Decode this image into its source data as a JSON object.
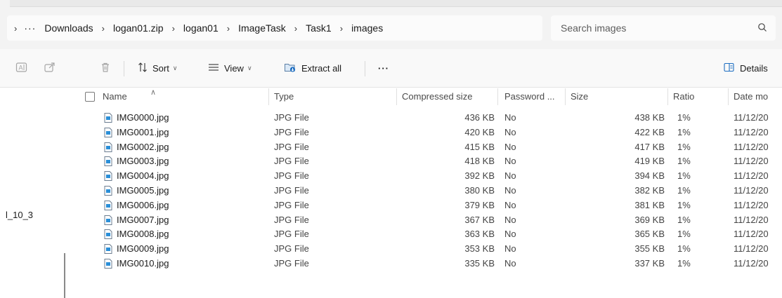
{
  "address": {
    "more": "···",
    "crumbs": [
      "Downloads",
      "logan01.zip",
      "logan01",
      "ImageTask",
      "Task1",
      "images"
    ]
  },
  "search": {
    "placeholder": "Search images"
  },
  "toolbar": {
    "sort": "Sort",
    "view": "View",
    "extract_all": "Extract all",
    "more": "···",
    "details": "Details"
  },
  "nav": {
    "partial_label": "l_10_3"
  },
  "columns": {
    "name": "Name",
    "type": "Type",
    "compressed": "Compressed size",
    "password": "Password ...",
    "size": "Size",
    "ratio": "Ratio",
    "date": "Date mo"
  },
  "files": [
    {
      "name": "IMG0000.jpg",
      "type": "JPG File",
      "compressed": "436 KB",
      "password": "No",
      "size": "438 KB",
      "ratio": "1%",
      "date": "11/12/20"
    },
    {
      "name": "IMG0001.jpg",
      "type": "JPG File",
      "compressed": "420 KB",
      "password": "No",
      "size": "422 KB",
      "ratio": "1%",
      "date": "11/12/20"
    },
    {
      "name": "IMG0002.jpg",
      "type": "JPG File",
      "compressed": "415 KB",
      "password": "No",
      "size": "417 KB",
      "ratio": "1%",
      "date": "11/12/20"
    },
    {
      "name": "IMG0003.jpg",
      "type": "JPG File",
      "compressed": "418 KB",
      "password": "No",
      "size": "419 KB",
      "ratio": "1%",
      "date": "11/12/20"
    },
    {
      "name": "IMG0004.jpg",
      "type": "JPG File",
      "compressed": "392 KB",
      "password": "No",
      "size": "394 KB",
      "ratio": "1%",
      "date": "11/12/20"
    },
    {
      "name": "IMG0005.jpg",
      "type": "JPG File",
      "compressed": "380 KB",
      "password": "No",
      "size": "382 KB",
      "ratio": "1%",
      "date": "11/12/20"
    },
    {
      "name": "IMG0006.jpg",
      "type": "JPG File",
      "compressed": "379 KB",
      "password": "No",
      "size": "381 KB",
      "ratio": "1%",
      "date": "11/12/20"
    },
    {
      "name": "IMG0007.jpg",
      "type": "JPG File",
      "compressed": "367 KB",
      "password": "No",
      "size": "369 KB",
      "ratio": "1%",
      "date": "11/12/20"
    },
    {
      "name": "IMG0008.jpg",
      "type": "JPG File",
      "compressed": "363 KB",
      "password": "No",
      "size": "365 KB",
      "ratio": "1%",
      "date": "11/12/20"
    },
    {
      "name": "IMG0009.jpg",
      "type": "JPG File",
      "compressed": "353 KB",
      "password": "No",
      "size": "355 KB",
      "ratio": "1%",
      "date": "11/12/20"
    },
    {
      "name": "IMG0010.jpg",
      "type": "JPG File",
      "compressed": "335 KB",
      "password": "No",
      "size": "337 KB",
      "ratio": "1%",
      "date": "11/12/20"
    }
  ]
}
